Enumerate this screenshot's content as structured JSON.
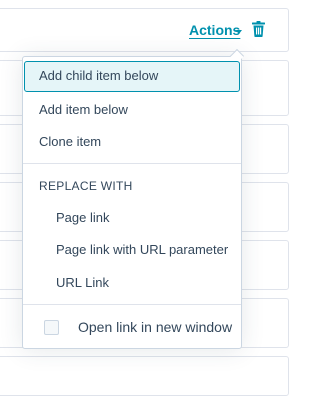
{
  "header": {
    "actions_label": "Actions"
  },
  "icons": {
    "caret": "chevron-down-icon",
    "delete": "trash-icon"
  },
  "menu": {
    "items": [
      {
        "label": "Add child item below"
      },
      {
        "label": "Add item below"
      },
      {
        "label": "Clone item"
      }
    ],
    "section_header": "REPLACE WITH",
    "replace_items": [
      {
        "label": "Page link"
      },
      {
        "label": "Page link with URL parameter"
      },
      {
        "label": "URL Link"
      }
    ],
    "checkbox": {
      "label": "Open link in new window",
      "checked": false
    }
  },
  "colors": {
    "accent": "#0091ae",
    "selected_bg": "#e5f5f8",
    "text": "#33475b",
    "border": "#cbd6e2"
  }
}
